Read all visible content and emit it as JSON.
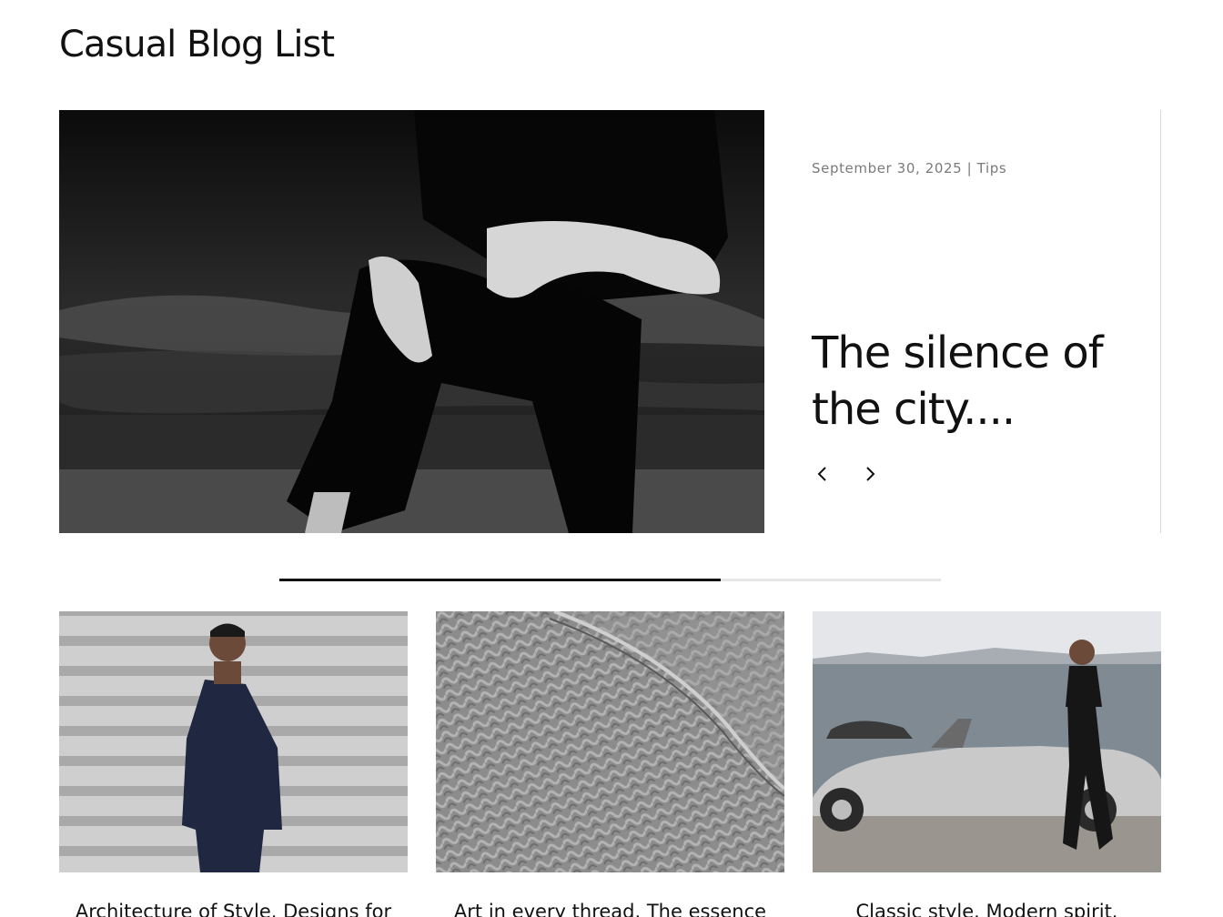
{
  "page": {
    "title": "Casual Blog List"
  },
  "hero": {
    "meta": "September 30, 2025 | Tips",
    "title": "The silence of the city....",
    "prev_icon": "chevron-left-icon",
    "next_icon": "chevron-right-icon"
  },
  "slider": {
    "progress": 0.667
  },
  "cards": [
    {
      "title": "Architecture of Style. Designs for"
    },
    {
      "title": "Art in every thread. The essence"
    },
    {
      "title": "Classic style. Modern spirit."
    }
  ],
  "colors": {
    "text": "#111111",
    "meta": "#7a7a7a",
    "track": "#e6e6e6",
    "fill": "#111111"
  }
}
